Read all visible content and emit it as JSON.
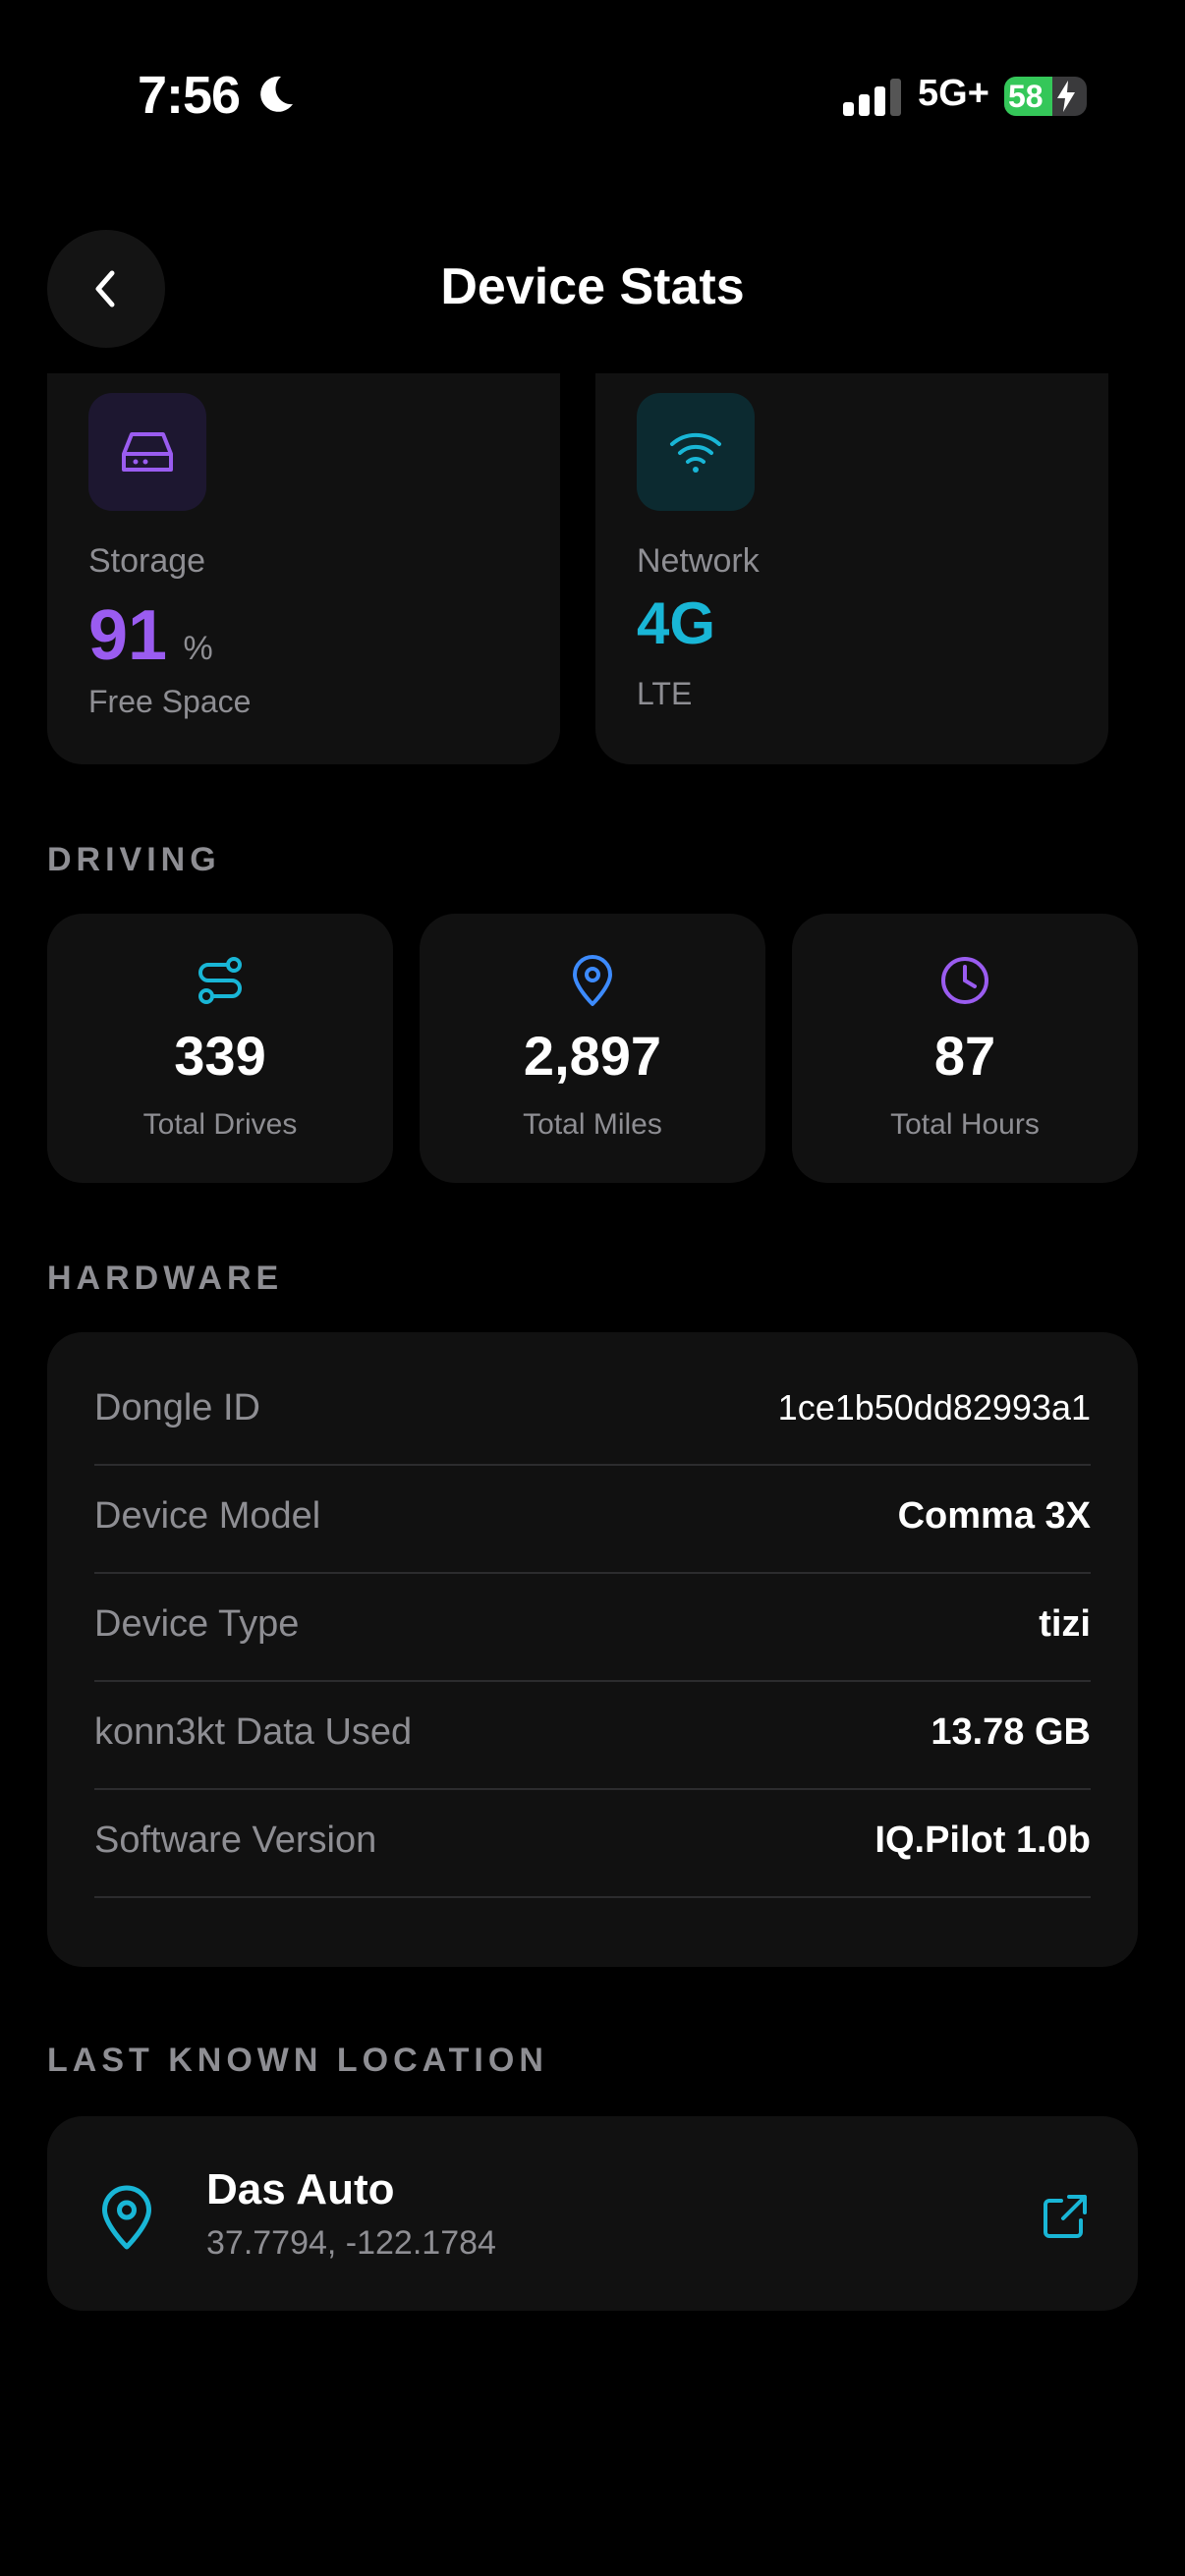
{
  "status_bar": {
    "time": "7:56",
    "network": "5G+",
    "battery_percent": "58",
    "battery_level": 0.58
  },
  "header": {
    "title": "Device Stats"
  },
  "storage": {
    "label": "Storage",
    "value": "91",
    "unit": "%",
    "sublabel": "Free Space",
    "color": "#9a5cf0"
  },
  "network": {
    "label": "Network",
    "value": "4G",
    "sublabel": "LTE",
    "color": "#19b6d6"
  },
  "sections": {
    "driving": "DRIVING",
    "hardware": "HARDWARE",
    "location": "LAST KNOWN LOCATION"
  },
  "driving": [
    {
      "value": "339",
      "label": "Total Drives",
      "icon": "route-icon",
      "color": "#19b6d6"
    },
    {
      "value": "2,897",
      "label": "Total Miles",
      "icon": "map-pin-icon",
      "color": "#3d8bfd"
    },
    {
      "value": "87",
      "label": "Total Hours",
      "icon": "clock-icon",
      "color": "#9a5cf0"
    }
  ],
  "hardware": [
    {
      "key": "Dongle ID",
      "value": "1ce1b50dd82993a1"
    },
    {
      "key": "Device Model",
      "value": "Comma 3X"
    },
    {
      "key": "Device Type",
      "value": "tizi"
    },
    {
      "key": "konn3kt Data Used",
      "value": "13.78 GB"
    },
    {
      "key": "Software Version",
      "value": "IQ.Pilot 1.0b"
    }
  ],
  "location": {
    "name": "Das Auto",
    "coords": "37.7794, -122.1784",
    "icon": "map-pin-icon",
    "action_icon": "external-link-icon",
    "color": "#19b6d6"
  }
}
